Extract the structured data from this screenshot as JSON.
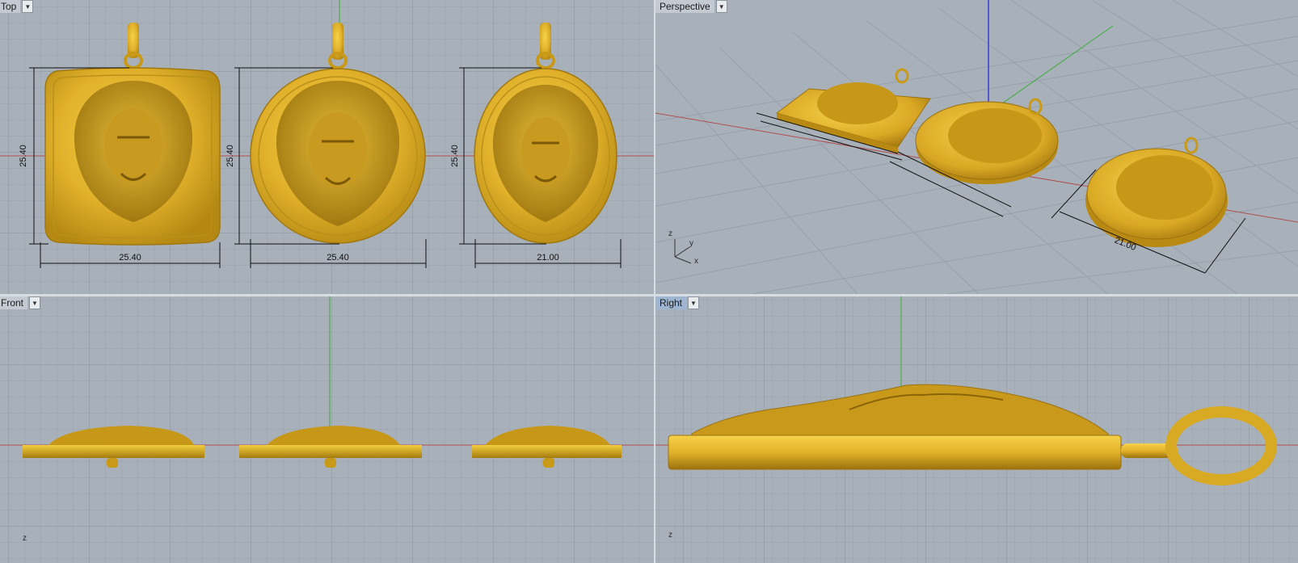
{
  "viewports": {
    "top": {
      "title": "Top"
    },
    "perspective": {
      "title": "Perspective"
    },
    "front": {
      "title": "Front"
    },
    "right": {
      "title": "Right"
    }
  },
  "dimensions": {
    "square": {
      "height": "25.40",
      "width": "25.40"
    },
    "round": {
      "height": "25.40",
      "width": "25.40"
    },
    "oval": {
      "height": "25.40",
      "width": "21.00"
    },
    "perspective_oval_width": "21.00"
  },
  "axes": {
    "x": "x",
    "y": "y",
    "z": "z"
  },
  "icons": {
    "dropdown": "chevron-down-icon"
  },
  "colors": {
    "viewport_bg": "#a8b0ba",
    "grid_minor": "#9aa3ad",
    "grid_major": "#8c959f",
    "x_axis": "#b05050",
    "y_axis": "#3cae3c",
    "z_axis": "#3a3ad0",
    "gold": "#d4a61e",
    "gold_light": "#f2cc3c",
    "gold_dark": "#a07810",
    "active_title": "#9fb6d3"
  }
}
